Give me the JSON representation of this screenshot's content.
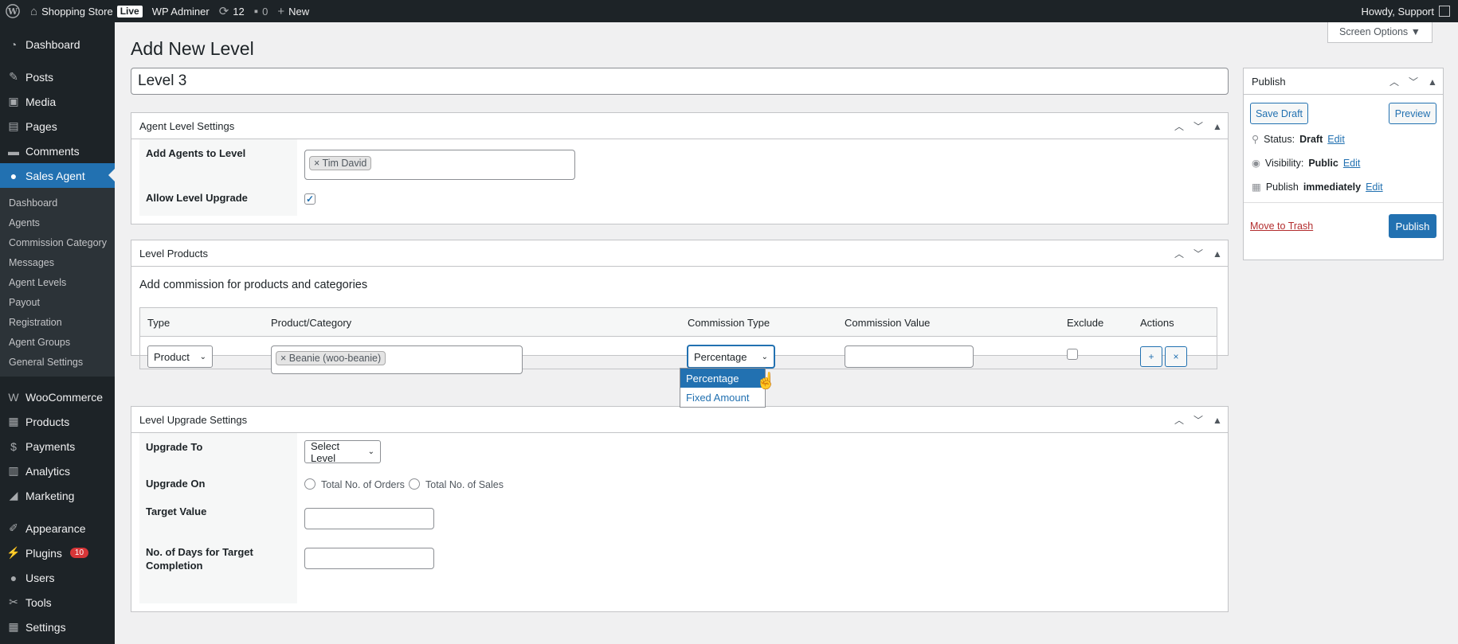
{
  "adminbar": {
    "site_name": "Shopping Store",
    "live_label": "Live",
    "admin_label": "WP Adminer",
    "updates_count": "12",
    "comments_count": "0",
    "new_label": "New",
    "howdy": "Howdy, Support"
  },
  "sidebar": {
    "dashboard": "Dashboard",
    "posts": "Posts",
    "media": "Media",
    "pages": "Pages",
    "comments": "Comments",
    "sales_agent": "Sales Agent",
    "sub": {
      "dashboard": "Dashboard",
      "agents": "Agents",
      "commission_category": "Commission Category",
      "messages": "Messages",
      "agent_levels": "Agent Levels",
      "payout": "Payout",
      "registration": "Registration",
      "agent_groups": "Agent Groups",
      "general_settings": "General Settings"
    },
    "woocommerce": "WooCommerce",
    "products": "Products",
    "payments": "Payments",
    "analytics": "Analytics",
    "marketing": "Marketing",
    "appearance": "Appearance",
    "plugins": "Plugins",
    "plugins_badge": "10",
    "users": "Users",
    "tools": "Tools",
    "settings": "Settings"
  },
  "header": {
    "screen_options": "Screen Options ▼",
    "page_title": "Add New Level",
    "level_title_value": "Level 3"
  },
  "agent_level_settings": {
    "title": "Agent Level Settings",
    "add_agents_label": "Add Agents to Level",
    "agent_chip": "Tim David",
    "allow_upgrade_label": "Allow Level Upgrade",
    "allow_upgrade_checked": true
  },
  "level_products": {
    "title": "Level Products",
    "subtitle": "Add commission for products and categories",
    "columns": {
      "type": "Type",
      "product_category": "Product/Category",
      "commission_type": "Commission Type",
      "commission_value": "Commission Value",
      "exclude": "Exclude",
      "actions": "Actions"
    },
    "row": {
      "type_value": "Product",
      "product_chip": "Beanie (woo-beanie)",
      "commission_type_value": "Percentage",
      "commission_value": "",
      "add_btn": "+",
      "remove_btn": "×"
    },
    "dropdown_options": [
      "Percentage",
      "Fixed Amount"
    ]
  },
  "level_upgrade_settings": {
    "title": "Level Upgrade Settings",
    "upgrade_to_label": "Upgrade To",
    "upgrade_to_value": "Select Level",
    "upgrade_on_label": "Upgrade On",
    "option_orders": "Total No. of Orders",
    "option_sales": "Total No. of Sales",
    "target_value_label": "Target Value",
    "days_label": "No. of Days for Target Completion"
  },
  "publish": {
    "title": "Publish",
    "save_draft": "Save Draft",
    "preview": "Preview",
    "status_label": "Status:",
    "status_value": "Draft",
    "visibility_label": "Visibility:",
    "visibility_value": "Public",
    "publish_label": "Publish",
    "publish_value": "immediately",
    "edit_link": "Edit",
    "move_to_trash": "Move to Trash",
    "publish_button": "Publish"
  },
  "colors": {
    "accent": "#2271b1",
    "admin_bg": "#1d2327",
    "danger": "#b32d2e"
  }
}
